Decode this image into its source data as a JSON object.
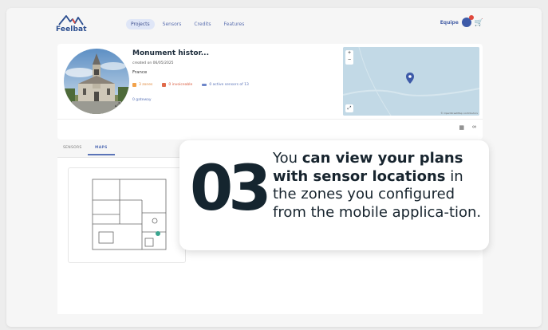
{
  "nav": {
    "logo_text": "Feelbat",
    "links": [
      {
        "label": "Projects",
        "active": true
      },
      {
        "label": "Sensors",
        "active": false
      },
      {
        "label": "Credits",
        "active": false
      },
      {
        "label": "Features",
        "active": false
      }
    ],
    "team_label": "Equipe",
    "icons": {
      "user": "user-icon",
      "notification": "notification-badge-icon",
      "cart": "cart-icon"
    }
  },
  "site": {
    "title": "Monument histor...",
    "created": "created on 06/05/2025",
    "country": "France",
    "stats": {
      "zones": "3 zones",
      "invoicable": "0 invoiceable",
      "sensors": "0 active sensors of 13"
    },
    "gateway": "0 gateway"
  },
  "map": {
    "zoom_in": "+",
    "zoom_out": "−",
    "attribution": "© OpenStreetMap contributors"
  },
  "tabs": [
    {
      "label": "SENSORS",
      "active": false
    },
    {
      "label": "MAPS",
      "active": true
    }
  ],
  "overlay": {
    "step": "03",
    "text_1": "You ",
    "text_2": "can view your plans with sensor locations",
    "text_3": " in the zones you configured from the mobile applica-tion."
  },
  "colors": {
    "accent": "#5b74b8",
    "dark": "#15252f",
    "zones": "#f2a24a",
    "invoiceable": "#e06a4a",
    "map_water": "#c2d9e6",
    "sensor_dot": "#3aa58f"
  }
}
